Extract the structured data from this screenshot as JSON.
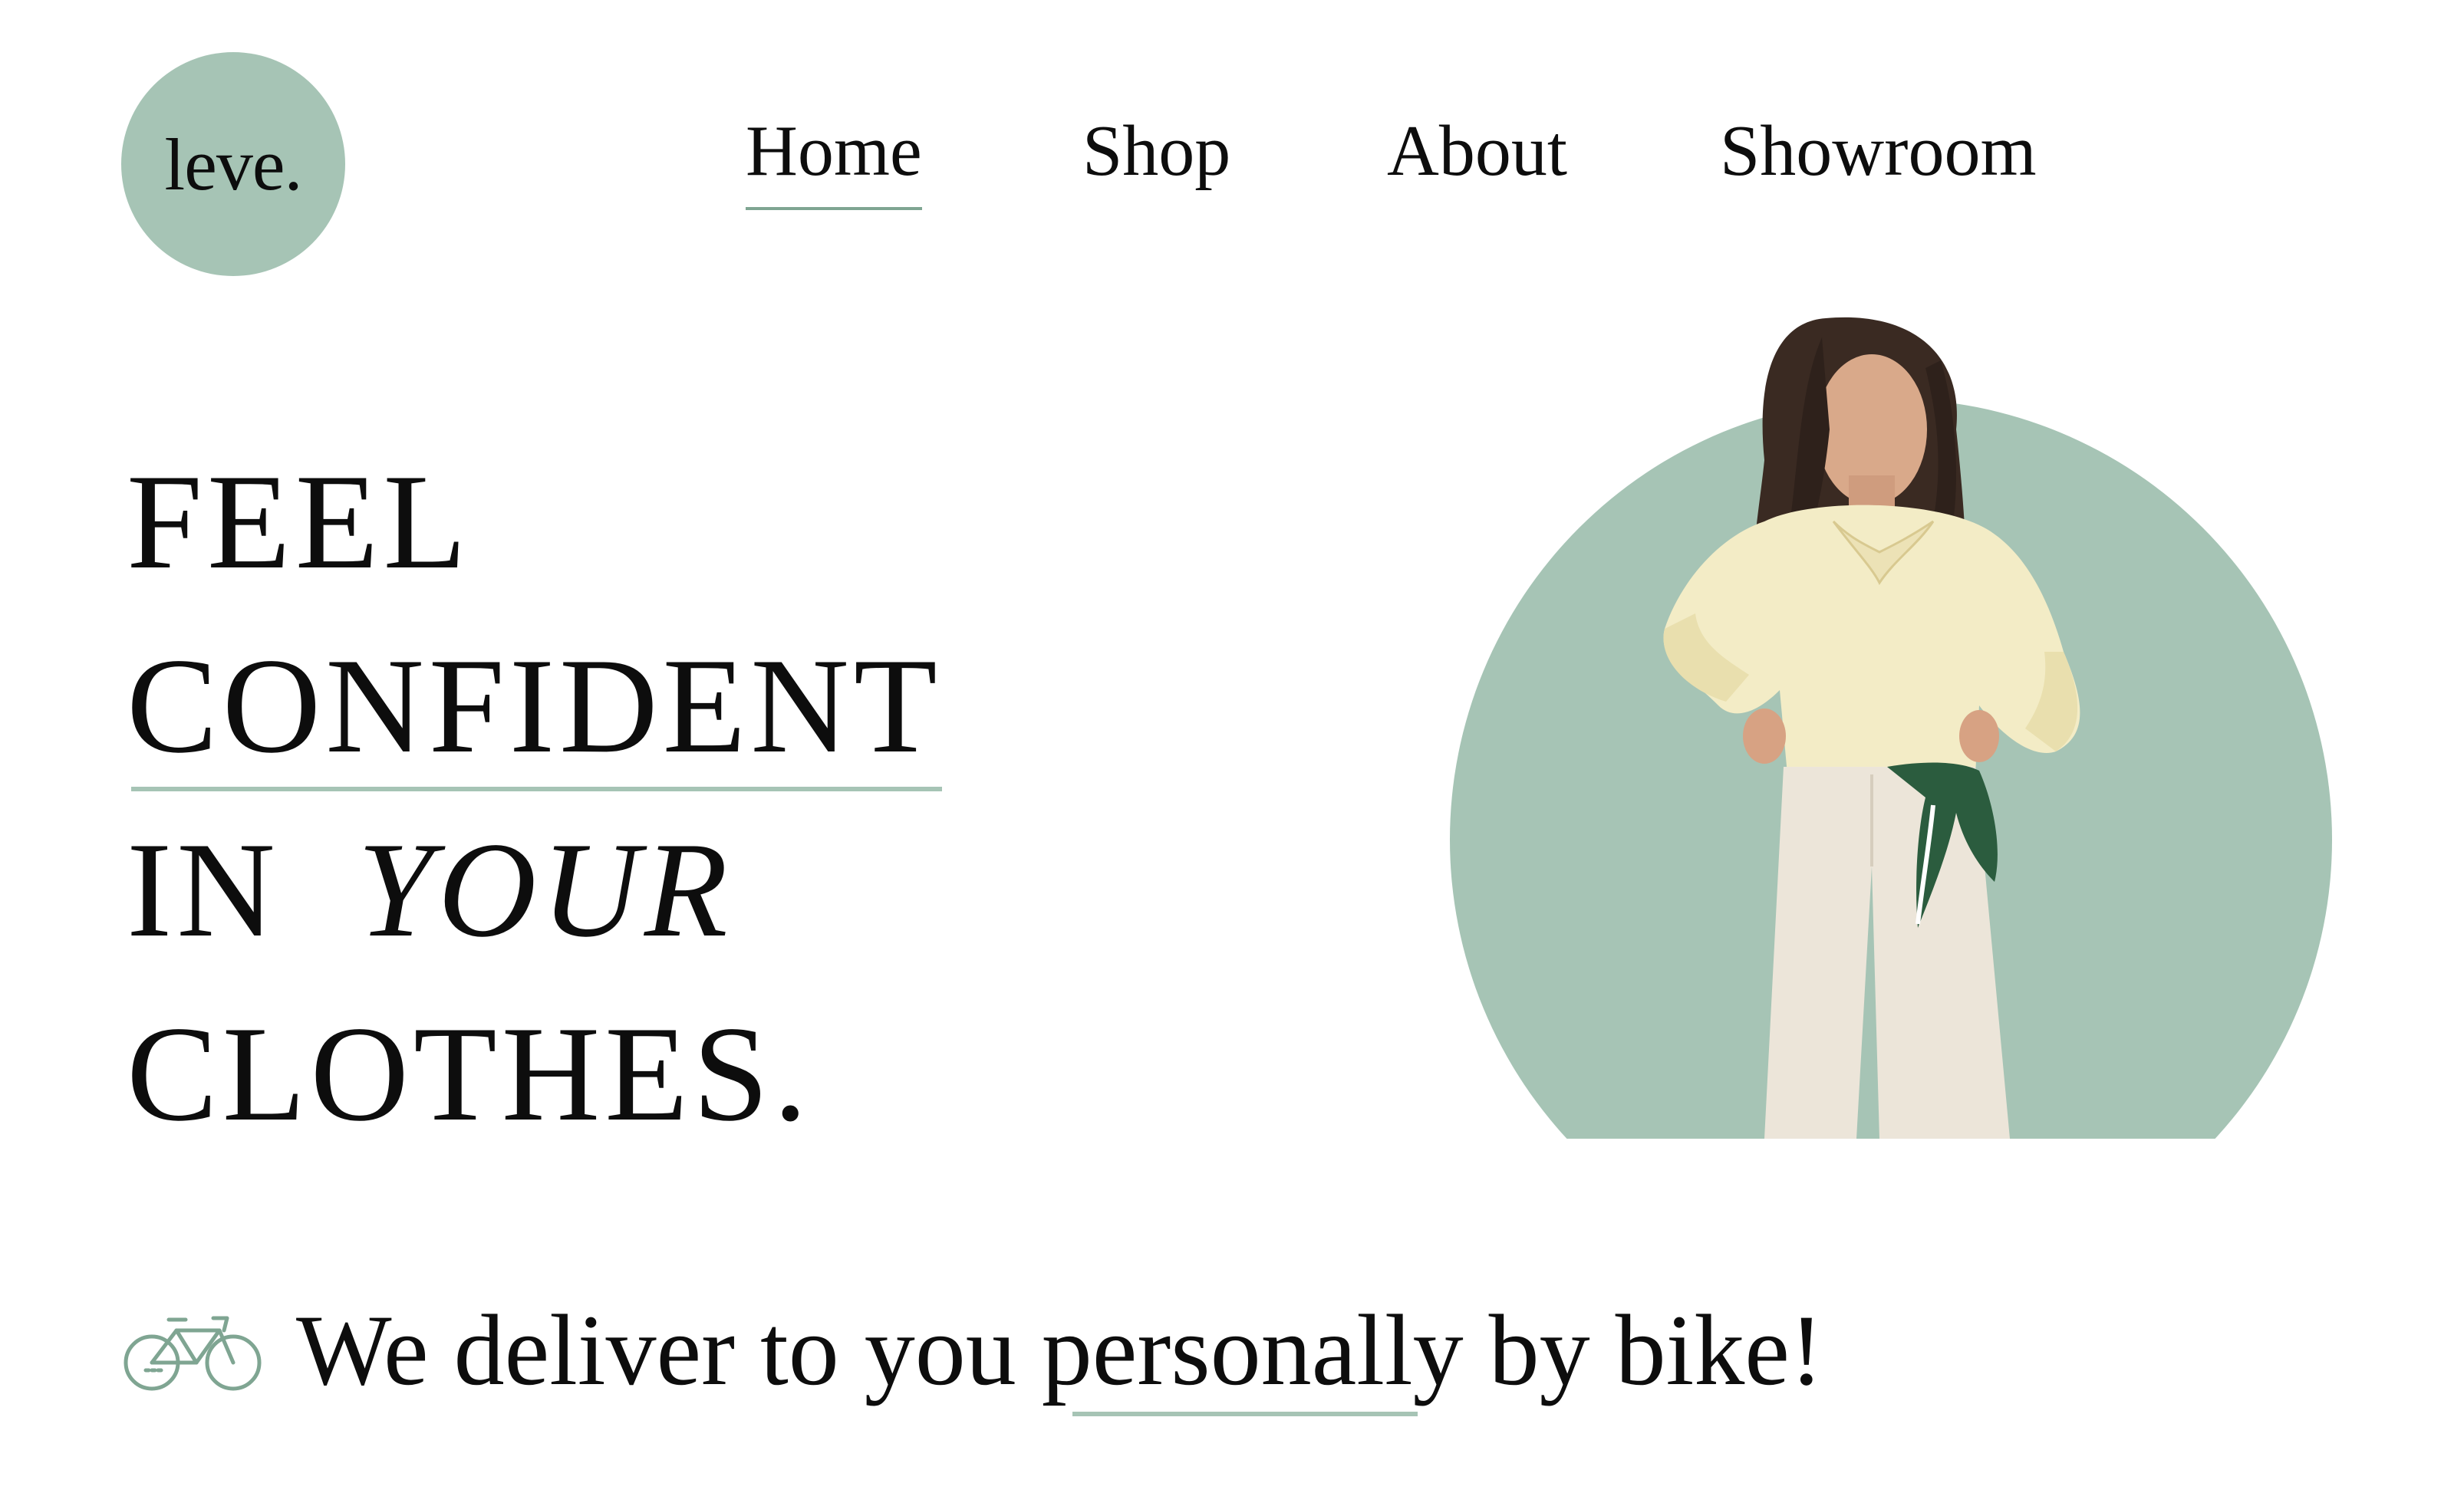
{
  "brand": {
    "logo_text": "leve.",
    "accent_color": "#a6c4b5",
    "accent_dark": "#7fa592"
  },
  "nav": {
    "items": [
      {
        "label": "Home",
        "active": true
      },
      {
        "label": "Shop",
        "active": false
      },
      {
        "label": "About",
        "active": false
      },
      {
        "label": "Showroom",
        "active": false
      }
    ]
  },
  "hero": {
    "headline": {
      "line1": "FEEL",
      "line2": "CONFIDENT",
      "line3a": "IN",
      "line3b": "YOUR",
      "line4": "CLOTHES."
    },
    "image_subject": "model-photo"
  },
  "delivery": {
    "icon": "bike-icon",
    "text_before": "We deliver to you ",
    "text_underlined": "personally",
    "text_after": " by bike!"
  }
}
